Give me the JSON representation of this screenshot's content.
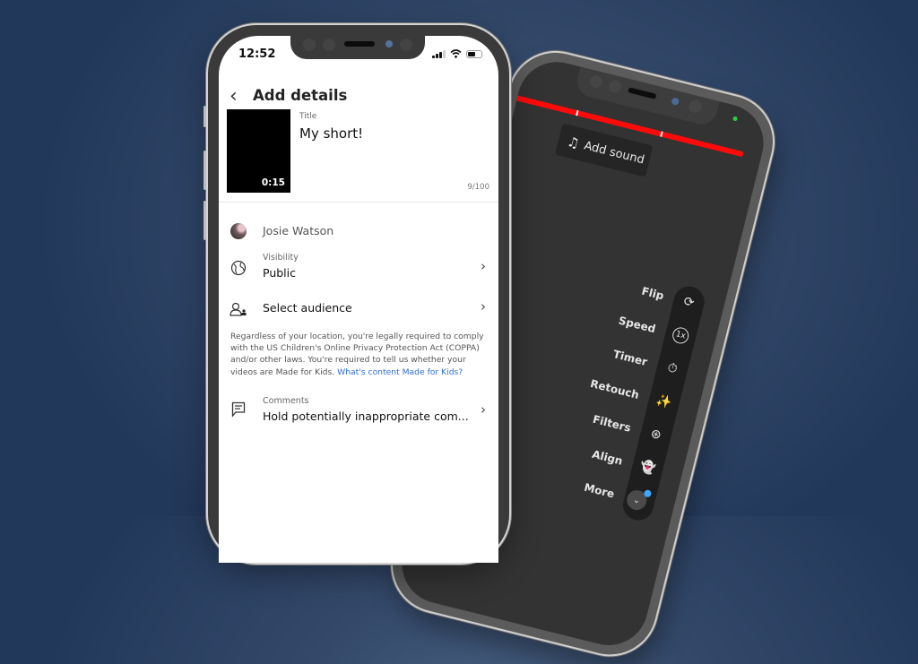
{
  "left_phone": {
    "status_bar": {
      "time": "12:52",
      "icons": [
        "cellular-signal-icon",
        "wifi-icon",
        "battery-icon"
      ],
      "battery_level_percent": 50
    },
    "header": {
      "back_icon": "chevron-left-icon",
      "title": "Add details"
    },
    "video": {
      "duration": "0:15",
      "title_label": "Title",
      "title_value": "My short!",
      "char_counter": "9/100"
    },
    "account": {
      "name": "Josie Watson"
    },
    "visibility": {
      "icon": "globe-icon",
      "label": "Visibility",
      "value": "Public"
    },
    "audience": {
      "icon": "person-audience-icon",
      "label": "Select audience"
    },
    "notice": {
      "text": "Regardless of your location, you're legally required to comply with the US Children's Online Privacy Protection Act (COPPA) and/or other laws. You're required to tell us whether your videos are Made for Kids.",
      "link": "What's content Made for Kids?"
    },
    "comments": {
      "icon": "comment-icon",
      "label": "Comments",
      "value": "Hold potentially inappropriate com..."
    }
  },
  "right_phone": {
    "add_sound_label": "Add sound",
    "add_sound_icon": "music-note-icon",
    "progress_color": "#ff0a0a",
    "tools": [
      {
        "label": "Flip",
        "icon": "flip-camera-icon",
        "glyph": "⟳"
      },
      {
        "label": "Speed",
        "icon": "speed-icon",
        "glyph": "1x"
      },
      {
        "label": "Timer",
        "icon": "timer-icon",
        "glyph": "⏱"
      },
      {
        "label": "Retouch",
        "icon": "magic-wand-icon",
        "glyph": "✨"
      },
      {
        "label": "Filters",
        "icon": "filters-icon",
        "glyph": "⊛"
      },
      {
        "label": "Align",
        "icon": "ghost-icon",
        "glyph": "👻"
      },
      {
        "label": "More",
        "icon": "chevron-down-icon",
        "glyph": "⌄"
      }
    ]
  },
  "colors": {
    "background": "#22385a",
    "link": "#2f6fd6",
    "notification_dot": "#3ea6ff"
  }
}
